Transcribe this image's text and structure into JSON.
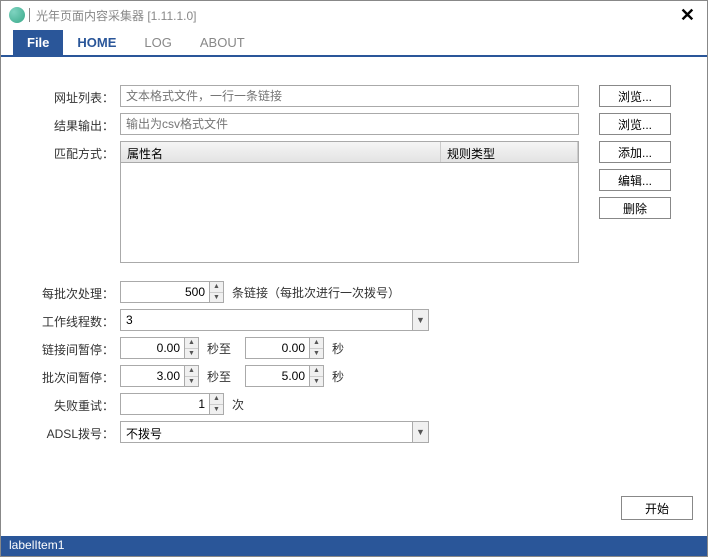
{
  "window": {
    "title": "光年页面内容采集器 [1.11.1.0]",
    "close": "✕"
  },
  "menu": {
    "file": "File",
    "home": "HOME",
    "log": "LOG",
    "about": "ABOUT"
  },
  "labels": {
    "url_list": "网址列表：",
    "output": "结果输出：",
    "match": "匹配方式：",
    "batch": "每批次处理：",
    "threads": "工作线程数：",
    "link_pause": "链接间暂停：",
    "batch_pause": "批次间暂停：",
    "retry": "失败重试：",
    "adsl": "ADSL拨号："
  },
  "inputs": {
    "url_list_ph": "文本格式文件，一行一条链接",
    "output_ph": "输出为csv格式文件",
    "batch": "500",
    "threads": "3",
    "link_pause_from": "0.00",
    "link_pause_to": "0.00",
    "batch_pause_from": "3.00",
    "batch_pause_to": "5.00",
    "retry": "1",
    "adsl": "不拨号"
  },
  "grid": {
    "col1": "属性名",
    "col2": "规则类型"
  },
  "buttons": {
    "browse": "浏览...",
    "add": "添加...",
    "edit": "编辑...",
    "delete": "删除",
    "start": "开始"
  },
  "after": {
    "batch": "条链接（每批次进行一次拨号）",
    "sec_to": "秒至",
    "sec": "秒",
    "times": "次"
  },
  "status": "labelItem1"
}
